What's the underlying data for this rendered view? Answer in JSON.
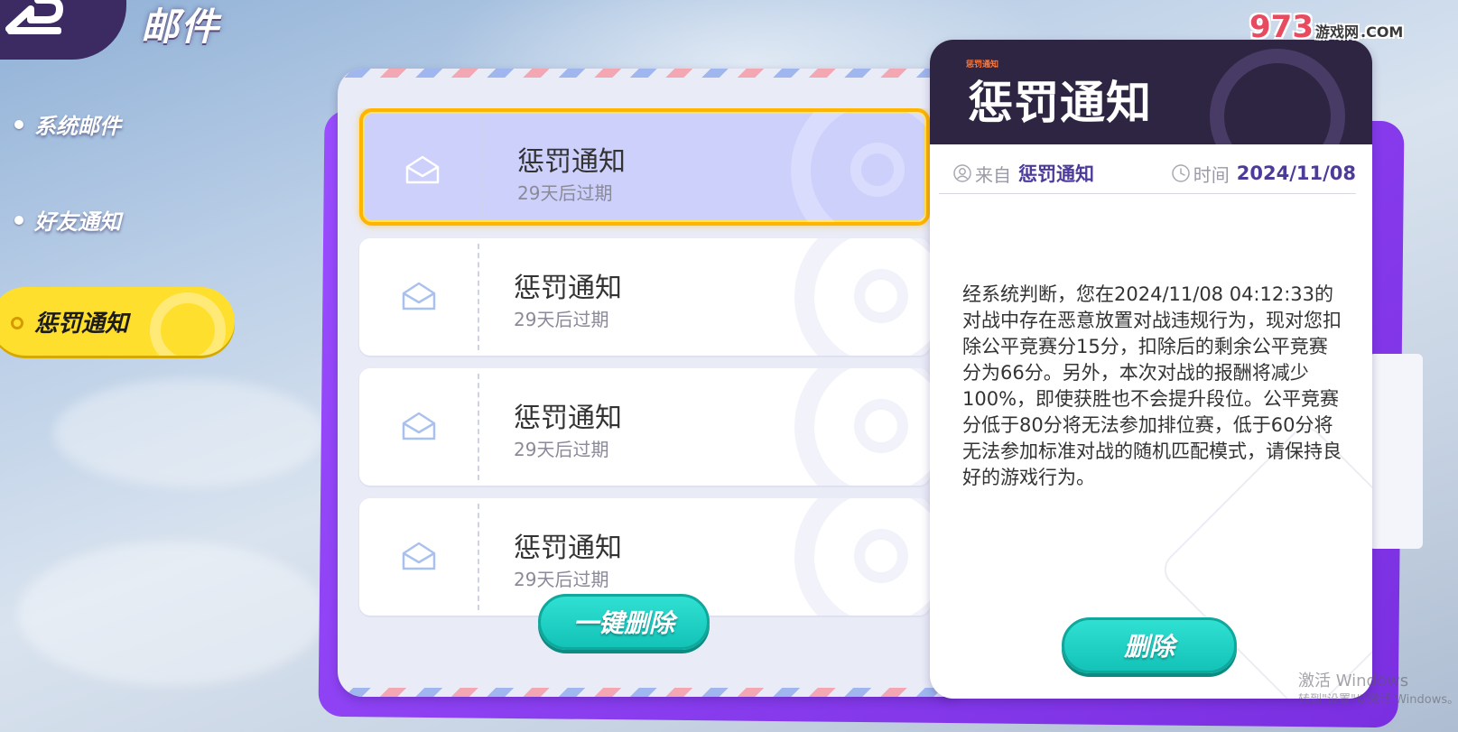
{
  "header": {
    "title": "邮件"
  },
  "nav": {
    "items": [
      {
        "label": "系统邮件"
      },
      {
        "label": "好友通知"
      },
      {
        "label": "惩罚通知"
      }
    ]
  },
  "mail_list": {
    "items": [
      {
        "title": "惩罚通知",
        "expiry": "29天后过期",
        "selected": true
      },
      {
        "title": "惩罚通知",
        "expiry": "29天后过期",
        "selected": false
      },
      {
        "title": "惩罚通知",
        "expiry": "29天后过期",
        "selected": false
      },
      {
        "title": "惩罚通知",
        "expiry": "29天后过期",
        "selected": false
      }
    ],
    "delete_all_label": "一键删除"
  },
  "detail": {
    "tag": "惩罚通知",
    "title": "惩罚通知",
    "from_label": "来自",
    "from_value": "惩罚通知",
    "time_label": "时间",
    "time_value": "2024/11/08",
    "body": "经系统判断，您在2024/11/08 04:12:33的对战中存在恶意放置对战违规行为，现对您扣除公平竞赛分15分，扣除后的剩余公平竞赛分为66分。另外，本次对战的报酬将减少100%，即使获胜也不会提升段位。公平竞赛分低于80分将无法参加排位赛，低于60分将无法参加标准对战的随机匹配模式，请保持良好的游戏行为。",
    "delete_label": "删除"
  },
  "watermark": {
    "site_logo": "973",
    "site_name": "游戏网",
    "site_domain": ".COM",
    "windows_line1": "激活 Windows",
    "windows_line2": "转到\"设置\"以激活 Windows。"
  },
  "colors": {
    "accent_yellow": "#ffdf2e",
    "button_teal": "#14c3b7",
    "panel_purple": "#8a3df0",
    "header_dark": "#2e2542",
    "meta_value": "#4d3b9a"
  }
}
